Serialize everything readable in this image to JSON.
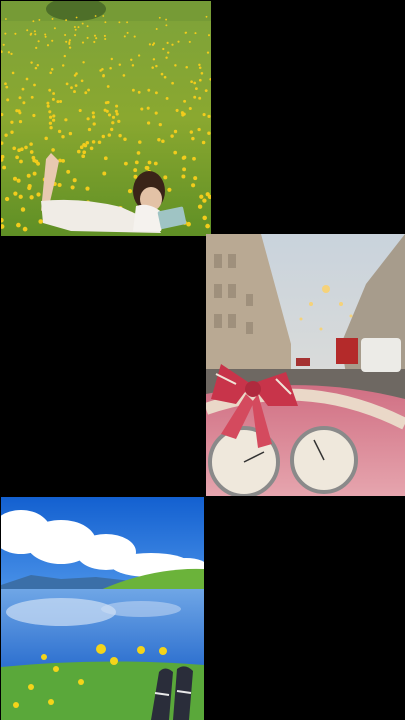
{
  "collage": {
    "background_color": "#000000",
    "tiles": [
      {
        "scene": "woman-reading-in-flower-meadow",
        "colors": {
          "grass": "#6f9e2c",
          "flowers": "#f2cc1c"
        }
      },
      {
        "scene": "car-dashboard-with-bow-on-rainy-city-street",
        "colors": {
          "dashboard": "#d88a97",
          "bow": "#c8344a"
        }
      },
      {
        "scene": "mountain-lake-with-wildflowers-and-sneakers",
        "colors": {
          "sky": "#1e6fd9",
          "water": "#3f86db",
          "grass": "#5aa83a"
        }
      }
    ]
  }
}
